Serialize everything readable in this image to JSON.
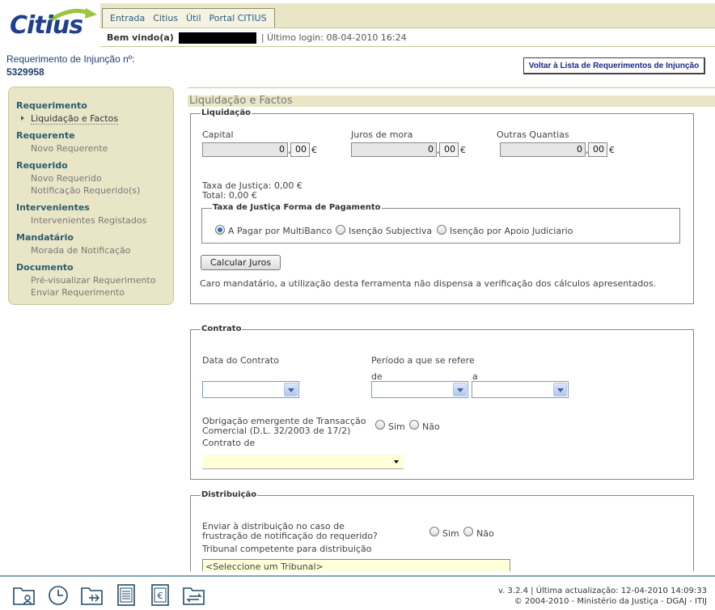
{
  "header": {
    "logo": "Citius",
    "menu": [
      "Entrada",
      "Citius",
      "Útil",
      "Portal CITIUS"
    ],
    "welcome_label": "Bem vindo(a)",
    "last_login": "| Último login: 08-04-2010 16:24"
  },
  "request": {
    "title": "Requerimento de Injunção nº:",
    "number": "5329958",
    "back_button": "Voltar à Lista de Requerimentos de Injunção"
  },
  "sidebar": {
    "sections": [
      {
        "title": "Requerimento",
        "items": [
          "Liquidação e Factos"
        ],
        "active": "Liquidação e Factos"
      },
      {
        "title": "Requerente",
        "items": [
          "Novo Requerente"
        ]
      },
      {
        "title": "Requerido",
        "items": [
          "Novo Requerido",
          "Notificação Requerido(s)"
        ]
      },
      {
        "title": "Intervenientes",
        "items": [
          "Intervenientes Registados"
        ]
      },
      {
        "title": "Mandatário",
        "items": [
          "Morada de Notificação"
        ]
      },
      {
        "title": "Documento",
        "items": [
          "Pré-visualizar Requerimento",
          "Enviar Requerimento"
        ]
      }
    ]
  },
  "main": {
    "section_title": "Liquidação e Factos",
    "liquidacao": {
      "legend": "Liquidação",
      "fields": [
        {
          "label": "Capital",
          "value": "0",
          "cents": "00",
          "currency": "€"
        },
        {
          "label": "Juros de mora",
          "value": "0",
          "cents": "00",
          "currency": "€"
        },
        {
          "label": "Outras Quantias",
          "value": "0",
          "cents": "00",
          "currency": "€"
        }
      ],
      "comma": ",",
      "taxa_justica": "Taxa de Justiça: 0,00 €",
      "total": "Total: 0,00 €",
      "pagamento": {
        "legend": "Taxa de Justiça Forma de Pagamento",
        "options": [
          "A Pagar por MultiBanco",
          "Isenção Subjectiva",
          "Isenção por Apoio Judiciario"
        ],
        "selected": "A Pagar por MultiBanco"
      },
      "calc_button": "Calcular Juros",
      "notice": "Caro mandatário, a utilização desta ferramenta não dispensa a verificação dos cálculos apresentados."
    },
    "contrato": {
      "legend": "Contrato",
      "data_label": "Data do Contrato",
      "periodo_label": "Período a que se refere",
      "de_label": "de",
      "a_label": "a",
      "obrigacao_line1": "Obrigação emergente de Transacção",
      "obrigacao_line2": "Comercial (D.L. 32/2003 de 17/2)",
      "sim": "Sim",
      "nao": "Não",
      "contrato_de_label": "Contrato de"
    },
    "distribuicao": {
      "legend": "Distribuição",
      "enviar_line1": "Enviar à distribuição no caso de",
      "enviar_line2": "frustração de notificação do requerido?",
      "sim": "Sim",
      "nao": "Não",
      "tribunal_label": "Tribunal competente para distribuição",
      "tribunal_value": "<Seleccione um Tribunal>"
    }
  },
  "footer": {
    "icons": [
      "folder-user-icon",
      "clock-icon",
      "folder-move-icon",
      "document-list-icon",
      "document-euro-icon",
      "folder-transfer-icon"
    ],
    "version": "v. 3.2.4 | Última actualização: 12-04-2010 14:09:33",
    "copyright": "© 2004-2010 - Ministério da Justiça - DGAJ - ITIJ"
  }
}
